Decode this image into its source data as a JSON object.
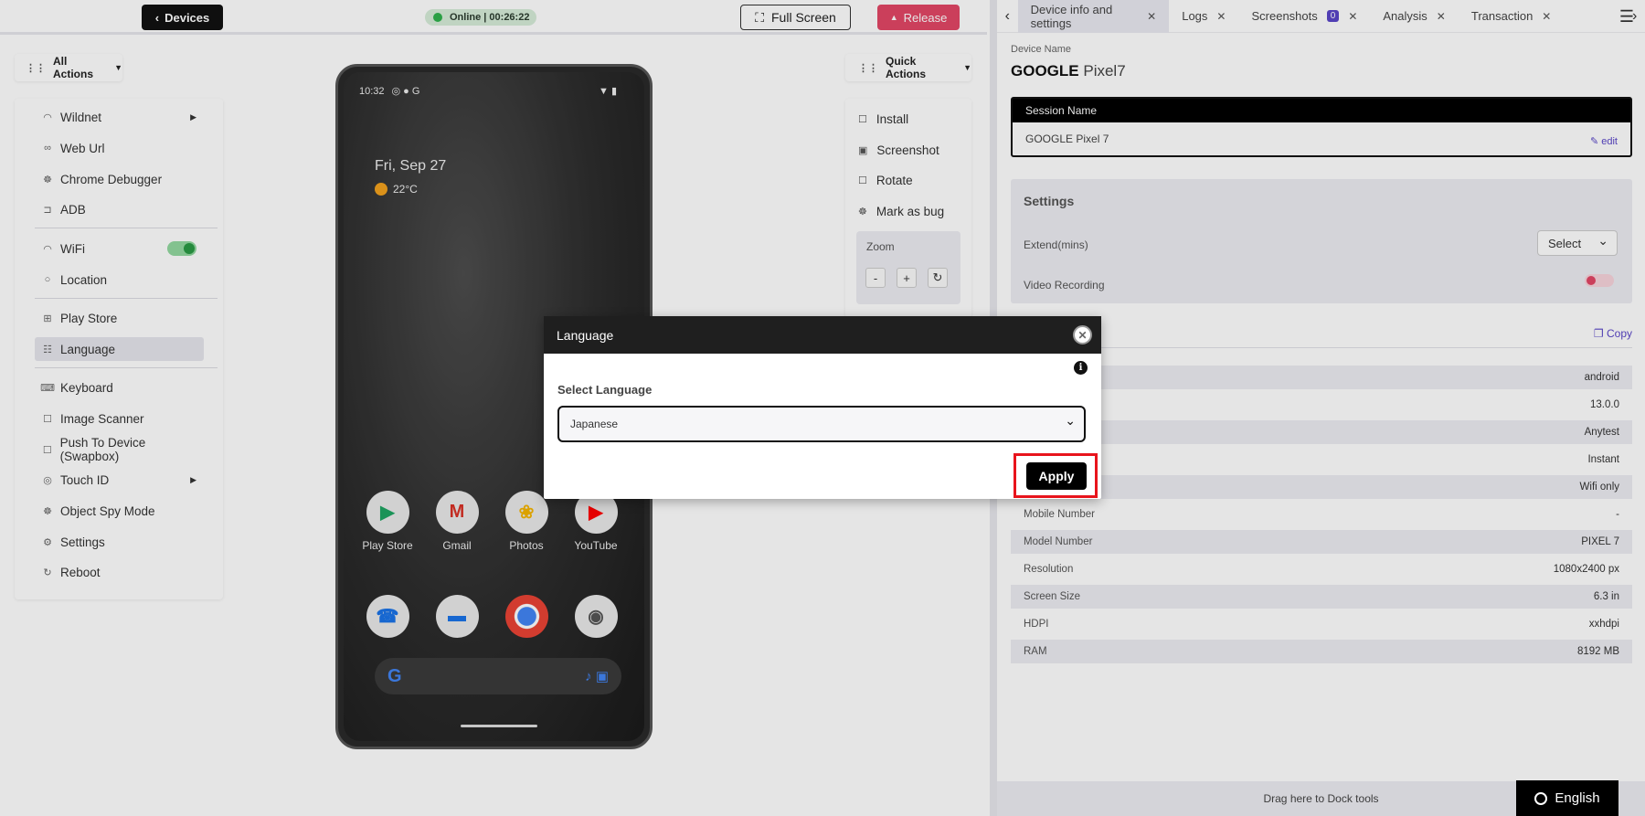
{
  "topbar": {
    "devices_label": "Devices",
    "online_text": "Online | 00:26:22",
    "fullscreen_label": "Full Screen",
    "release_label": "Release"
  },
  "left_menu": {
    "all_actions_label": "All Actions",
    "items": [
      {
        "label": "Wildnet",
        "icon": "wifi-icon"
      },
      {
        "label": "Web Url",
        "icon": "link-icon"
      },
      {
        "label": "Chrome Debugger",
        "icon": "bug-icon"
      },
      {
        "label": "ADB",
        "icon": "cable-icon"
      },
      {
        "label": "WiFi",
        "icon": "wifi-icon"
      },
      {
        "label": "Location",
        "icon": "location-icon"
      },
      {
        "label": "Play Store",
        "icon": "grid-icon"
      },
      {
        "label": "Language",
        "icon": "language-icon"
      },
      {
        "label": "Keyboard",
        "icon": "keyboard-icon"
      },
      {
        "label": "Image Scanner",
        "icon": "scanner-icon"
      },
      {
        "label": "Push To Device (Swapbox)",
        "icon": "push-icon"
      },
      {
        "label": "Touch ID",
        "icon": "fingerprint-icon"
      },
      {
        "label": "Object Spy Mode",
        "icon": "spy-icon"
      },
      {
        "label": "Settings",
        "icon": "gear-icon"
      },
      {
        "label": "Reboot",
        "icon": "reboot-icon"
      }
    ]
  },
  "phone": {
    "time": "10:32",
    "date": "Fri, Sep 27",
    "temperature": "22°C",
    "apps_row1": [
      "Play Store",
      "Gmail",
      "Photos",
      "YouTube"
    ]
  },
  "quick_actions": {
    "label": "Quick Actions",
    "items": [
      "Install",
      "Screenshot",
      "Rotate",
      "Mark as bug"
    ],
    "zoom_label": "Zoom",
    "zoom_minus": "-",
    "zoom_plus": "+"
  },
  "right_panel": {
    "tabs": [
      {
        "label": "Device info and settings"
      },
      {
        "label": "Logs"
      },
      {
        "label": "Screenshots",
        "badge": "0"
      },
      {
        "label": "Analysis"
      },
      {
        "label": "Transaction"
      }
    ],
    "device_name_label": "Device Name",
    "device_brand": "GOOGLE",
    "device_model": "Pixel7",
    "session_header": "Session Name",
    "session_value": "GOOGLE Pixel 7",
    "edit_label": "edit",
    "settings_title": "Settings",
    "extend_label": "Extend(mins)",
    "extend_value": "Select",
    "video_label": "Video Recording",
    "copy_label": "Copy",
    "info_rows": [
      {
        "key": "",
        "value": "android"
      },
      {
        "key": "",
        "value": "13.0.0"
      },
      {
        "key": "",
        "value": "Anytest"
      },
      {
        "key": "",
        "value": "Instant"
      },
      {
        "key": "",
        "value": "Wifi only"
      },
      {
        "key": "Mobile Number",
        "value": "-"
      },
      {
        "key": "Model Number",
        "value": "PIXEL 7"
      },
      {
        "key": "Resolution",
        "value": "1080x2400 px"
      },
      {
        "key": "Screen Size",
        "value": "6.3 in"
      },
      {
        "key": "HDPI",
        "value": "xxhdpi"
      },
      {
        "key": "RAM",
        "value": "8192 MB"
      }
    ],
    "dock_text": "Drag here to Dock tools",
    "language_button": "English"
  },
  "modal": {
    "title": "Language",
    "select_label": "Select Language",
    "selected_language": "Japanese",
    "apply_label": "Apply"
  },
  "colors": {
    "accent": "#5a46c8",
    "release": "#e34766",
    "online": "#2fb24c",
    "highlight": "#e8141c"
  }
}
